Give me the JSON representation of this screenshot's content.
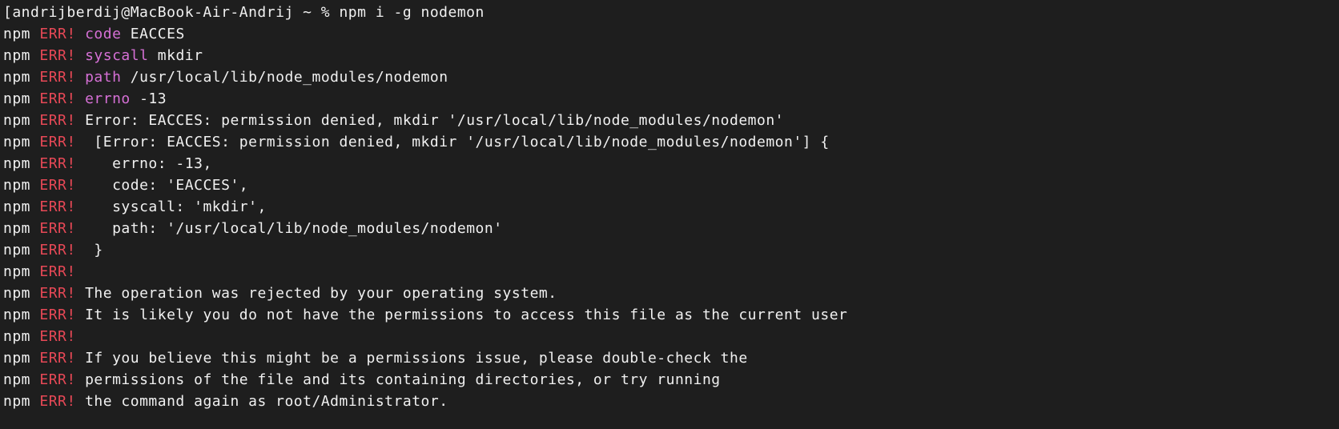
{
  "prompt": "[andrijberdij@MacBook-Air-Andrij ~ % npm i -g nodemon",
  "npm_label": "npm",
  "err_label": "ERR!",
  "lines": [
    {
      "key": "code",
      "value": "EACCES",
      "magenta": true
    },
    {
      "key": "syscall",
      "value": "mkdir",
      "magenta": true
    },
    {
      "key": "path",
      "value": "/usr/local/lib/node_modules/nodemon",
      "magenta": true
    },
    {
      "key": "errno",
      "value": "-13",
      "magenta": true
    },
    {
      "text": "Error: EACCES: permission denied, mkdir '/usr/local/lib/node_modules/nodemon'"
    },
    {
      "text": " [Error: EACCES: permission denied, mkdir '/usr/local/lib/node_modules/nodemon'] {"
    },
    {
      "text": "   errno: -13,"
    },
    {
      "text": "   code: 'EACCES',"
    },
    {
      "text": "   syscall: 'mkdir',"
    },
    {
      "text": "   path: '/usr/local/lib/node_modules/nodemon'"
    },
    {
      "text": " }"
    },
    {
      "text": ""
    },
    {
      "text": "The operation was rejected by your operating system."
    },
    {
      "text": "It is likely you do not have the permissions to access this file as the current user"
    },
    {
      "text": ""
    },
    {
      "text": "If you believe this might be a permissions issue, please double-check the"
    },
    {
      "text": "permissions of the file and its containing directories, or try running"
    },
    {
      "text": "the command again as root/Administrator."
    }
  ]
}
